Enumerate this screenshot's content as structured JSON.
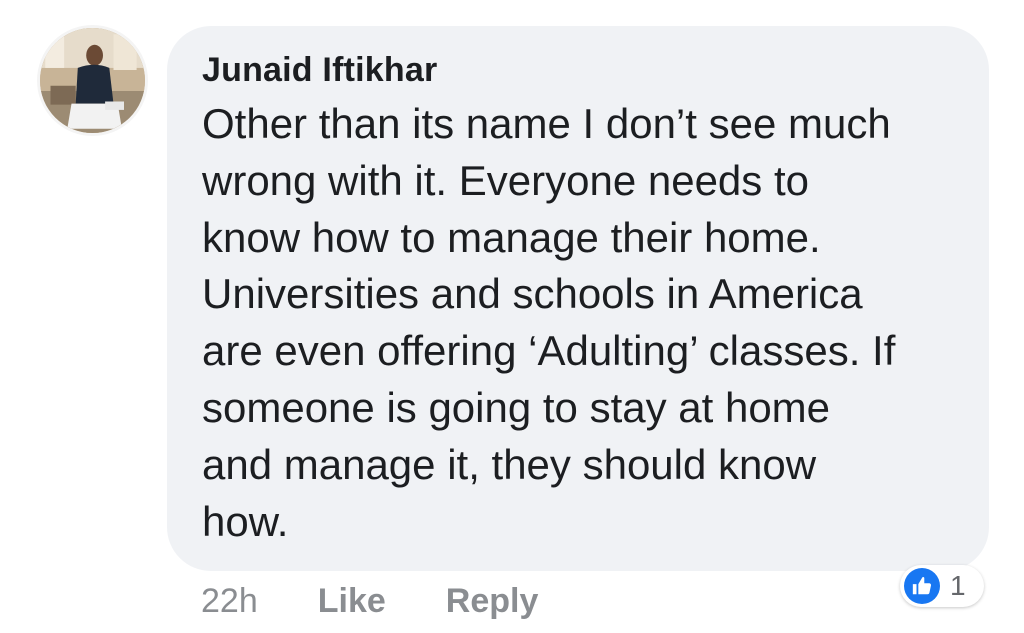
{
  "comment": {
    "author": "Junaid Iftikhar",
    "text_lines": [
      "Other than its name I don’t see much",
      "wrong with it. Everyone needs to",
      "know how to manage their home.",
      "Universities and schools in America",
      "are even offering ‘Adulting’ classes. If",
      "someone is going to stay at home",
      "and manage it, they should know",
      "how."
    ],
    "timestamp": "22h",
    "like_label": "Like",
    "reply_label": "Reply",
    "reaction": {
      "icon": "thumbs-up-icon",
      "count": "1",
      "color": "#1877f2"
    }
  },
  "colors": {
    "bubble": "#f0f2f5",
    "text": "#1c1e21",
    "meta": "#8a8d91"
  }
}
